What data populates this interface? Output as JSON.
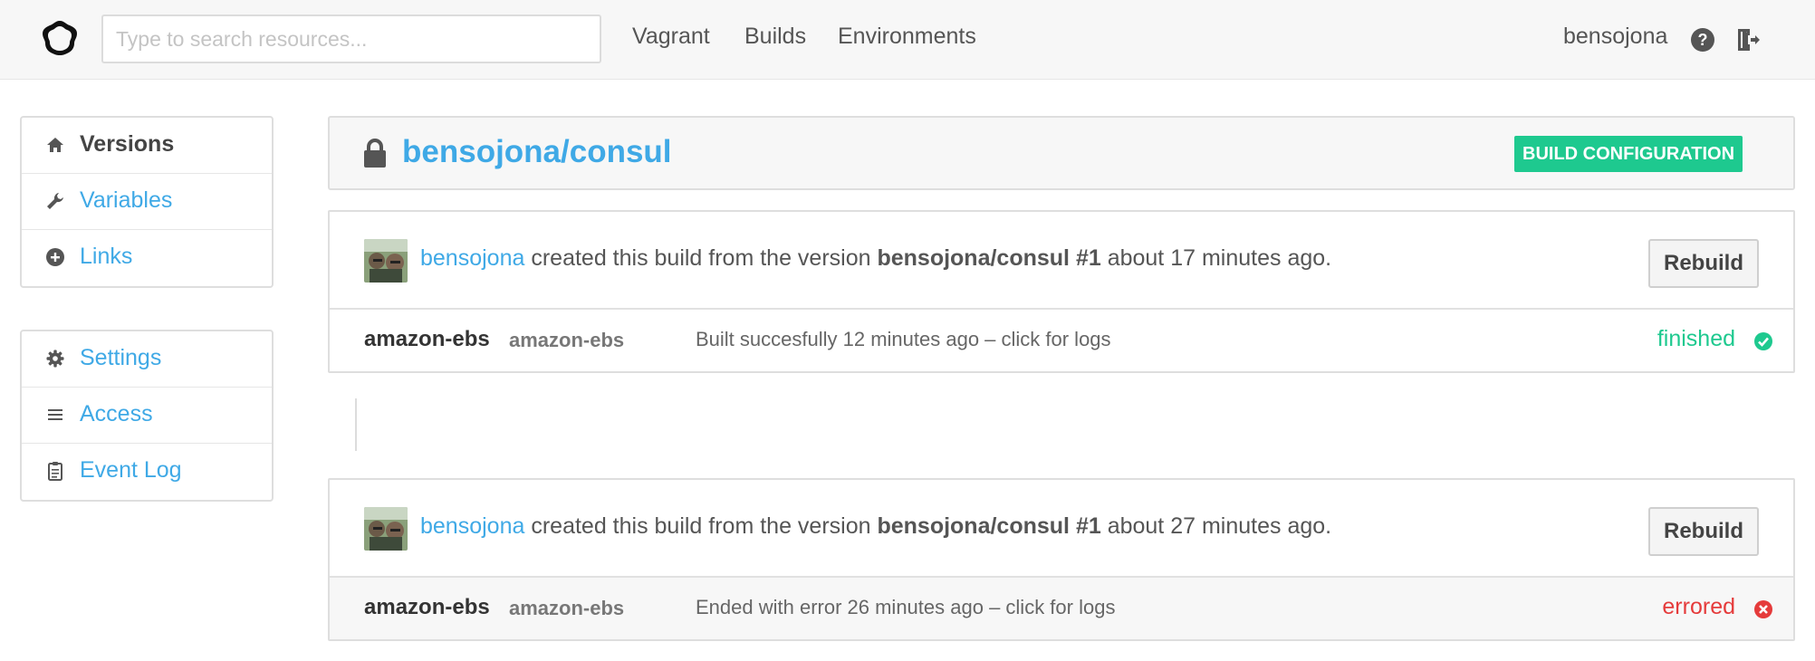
{
  "navbar": {
    "search_placeholder": "Type to search resources...",
    "links": [
      "Vagrant",
      "Builds",
      "Environments"
    ],
    "username": "bensojona",
    "icons": {
      "logo": "hexagon-logo-icon",
      "help": "help-circle-icon",
      "logout": "logout-icon"
    }
  },
  "sidebar": {
    "primary": [
      {
        "label": "Versions",
        "icon": "home-icon",
        "active": true
      },
      {
        "label": "Variables",
        "icon": "wrench-icon",
        "active": false
      },
      {
        "label": "Links",
        "icon": "plus-circle-icon",
        "active": false
      }
    ],
    "secondary": [
      {
        "label": "Settings",
        "icon": "gear-icon"
      },
      {
        "label": "Access",
        "icon": "list-icon"
      },
      {
        "label": "Event Log",
        "icon": "clipboard-icon"
      }
    ]
  },
  "header": {
    "title": "bensojona/consul",
    "build_config_label": "BUILD CONFIGURATION"
  },
  "builds": [
    {
      "user": "bensojona",
      "text_before_version": " created this build from the version ",
      "version": "bensojona/consul #1",
      "text_after_version": " about 17 minutes ago.",
      "rebuild_label": "Rebuild",
      "builder_name": "amazon-ebs",
      "builder_type": "amazon-ebs",
      "log_text": "Built succesfully 12 minutes ago – click for logs",
      "status": "finished"
    },
    {
      "user": "bensojona",
      "text_before_version": " created this build from the version ",
      "version": "bensojona/consul #1",
      "text_after_version": " about 27 minutes ago.",
      "rebuild_label": "Rebuild",
      "builder_name": "amazon-ebs",
      "builder_type": "amazon-ebs",
      "log_text": "Ended with error 26 minutes ago – click for logs",
      "status": "errored"
    }
  ],
  "colors": {
    "link": "#3fa9e6",
    "success": "#1ec98f",
    "error": "#e53b3b"
  }
}
